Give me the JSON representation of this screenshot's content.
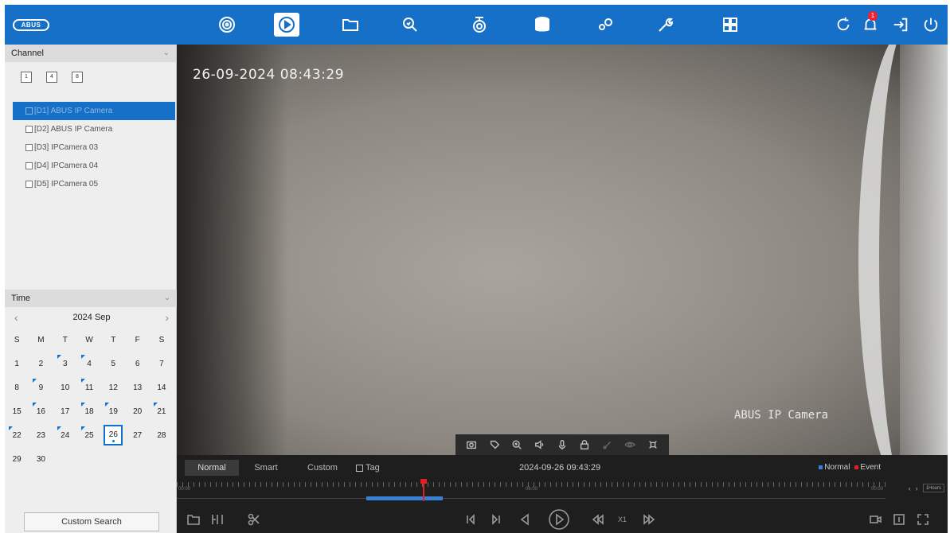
{
  "topbar": {
    "logo": "ABUS",
    "nav": [
      "live-view",
      "playback",
      "file-management",
      "smart-search",
      "camera",
      "storage",
      "configuration",
      "maintenance",
      "layout"
    ],
    "active": "playback",
    "alarm_count": "1"
  },
  "channel": {
    "header": "Channel",
    "layouts": [
      "1",
      "4",
      "8"
    ],
    "items": [
      {
        "label": "[D1] ABUS IP Camera",
        "selected": true
      },
      {
        "label": "[D2] ABUS IP Camera",
        "selected": false
      },
      {
        "label": "[D3] IPCamera 03",
        "selected": false
      },
      {
        "label": "[D4] IPCamera 04",
        "selected": false
      },
      {
        "label": "[D5] IPCamera 05",
        "selected": false
      }
    ]
  },
  "time": {
    "header": "Time",
    "month": "2024 Sep",
    "weekdays": [
      "S",
      "M",
      "T",
      "W",
      "T",
      "F",
      "S"
    ],
    "days": [
      "1",
      "2",
      "3",
      "4",
      "5",
      "6",
      "7",
      "8",
      "9",
      "10",
      "11",
      "12",
      "13",
      "14",
      "15",
      "16",
      "17",
      "18",
      "19",
      "20",
      "21",
      "22",
      "23",
      "24",
      "25",
      "26",
      "27",
      "28",
      "29",
      "30"
    ],
    "recorded_days": [
      "3",
      "4",
      "9",
      "11",
      "16",
      "18",
      "19",
      "21",
      "22",
      "24",
      "25",
      "26"
    ],
    "selected_day": "26",
    "custom_search": "Custom Search"
  },
  "video": {
    "osd_time": "26-09-2024 08:43:29",
    "osd_name": "ABUS IP Camera"
  },
  "playback": {
    "modes": [
      "Normal",
      "Smart",
      "Custom"
    ],
    "active_mode": "Normal",
    "tag_label": "Tag",
    "current_time": "2024-09-26 09:43:29",
    "legend_normal": "Normal",
    "legend_event": "Event",
    "colors": {
      "normal": "#3a7fd6",
      "event": "#e02020",
      "accent": "#1670c8"
    },
    "speed": "X1",
    "tick_labels": [
      "00:00",
      "06:00",
      "00:00"
    ],
    "scale": "1Hours"
  }
}
